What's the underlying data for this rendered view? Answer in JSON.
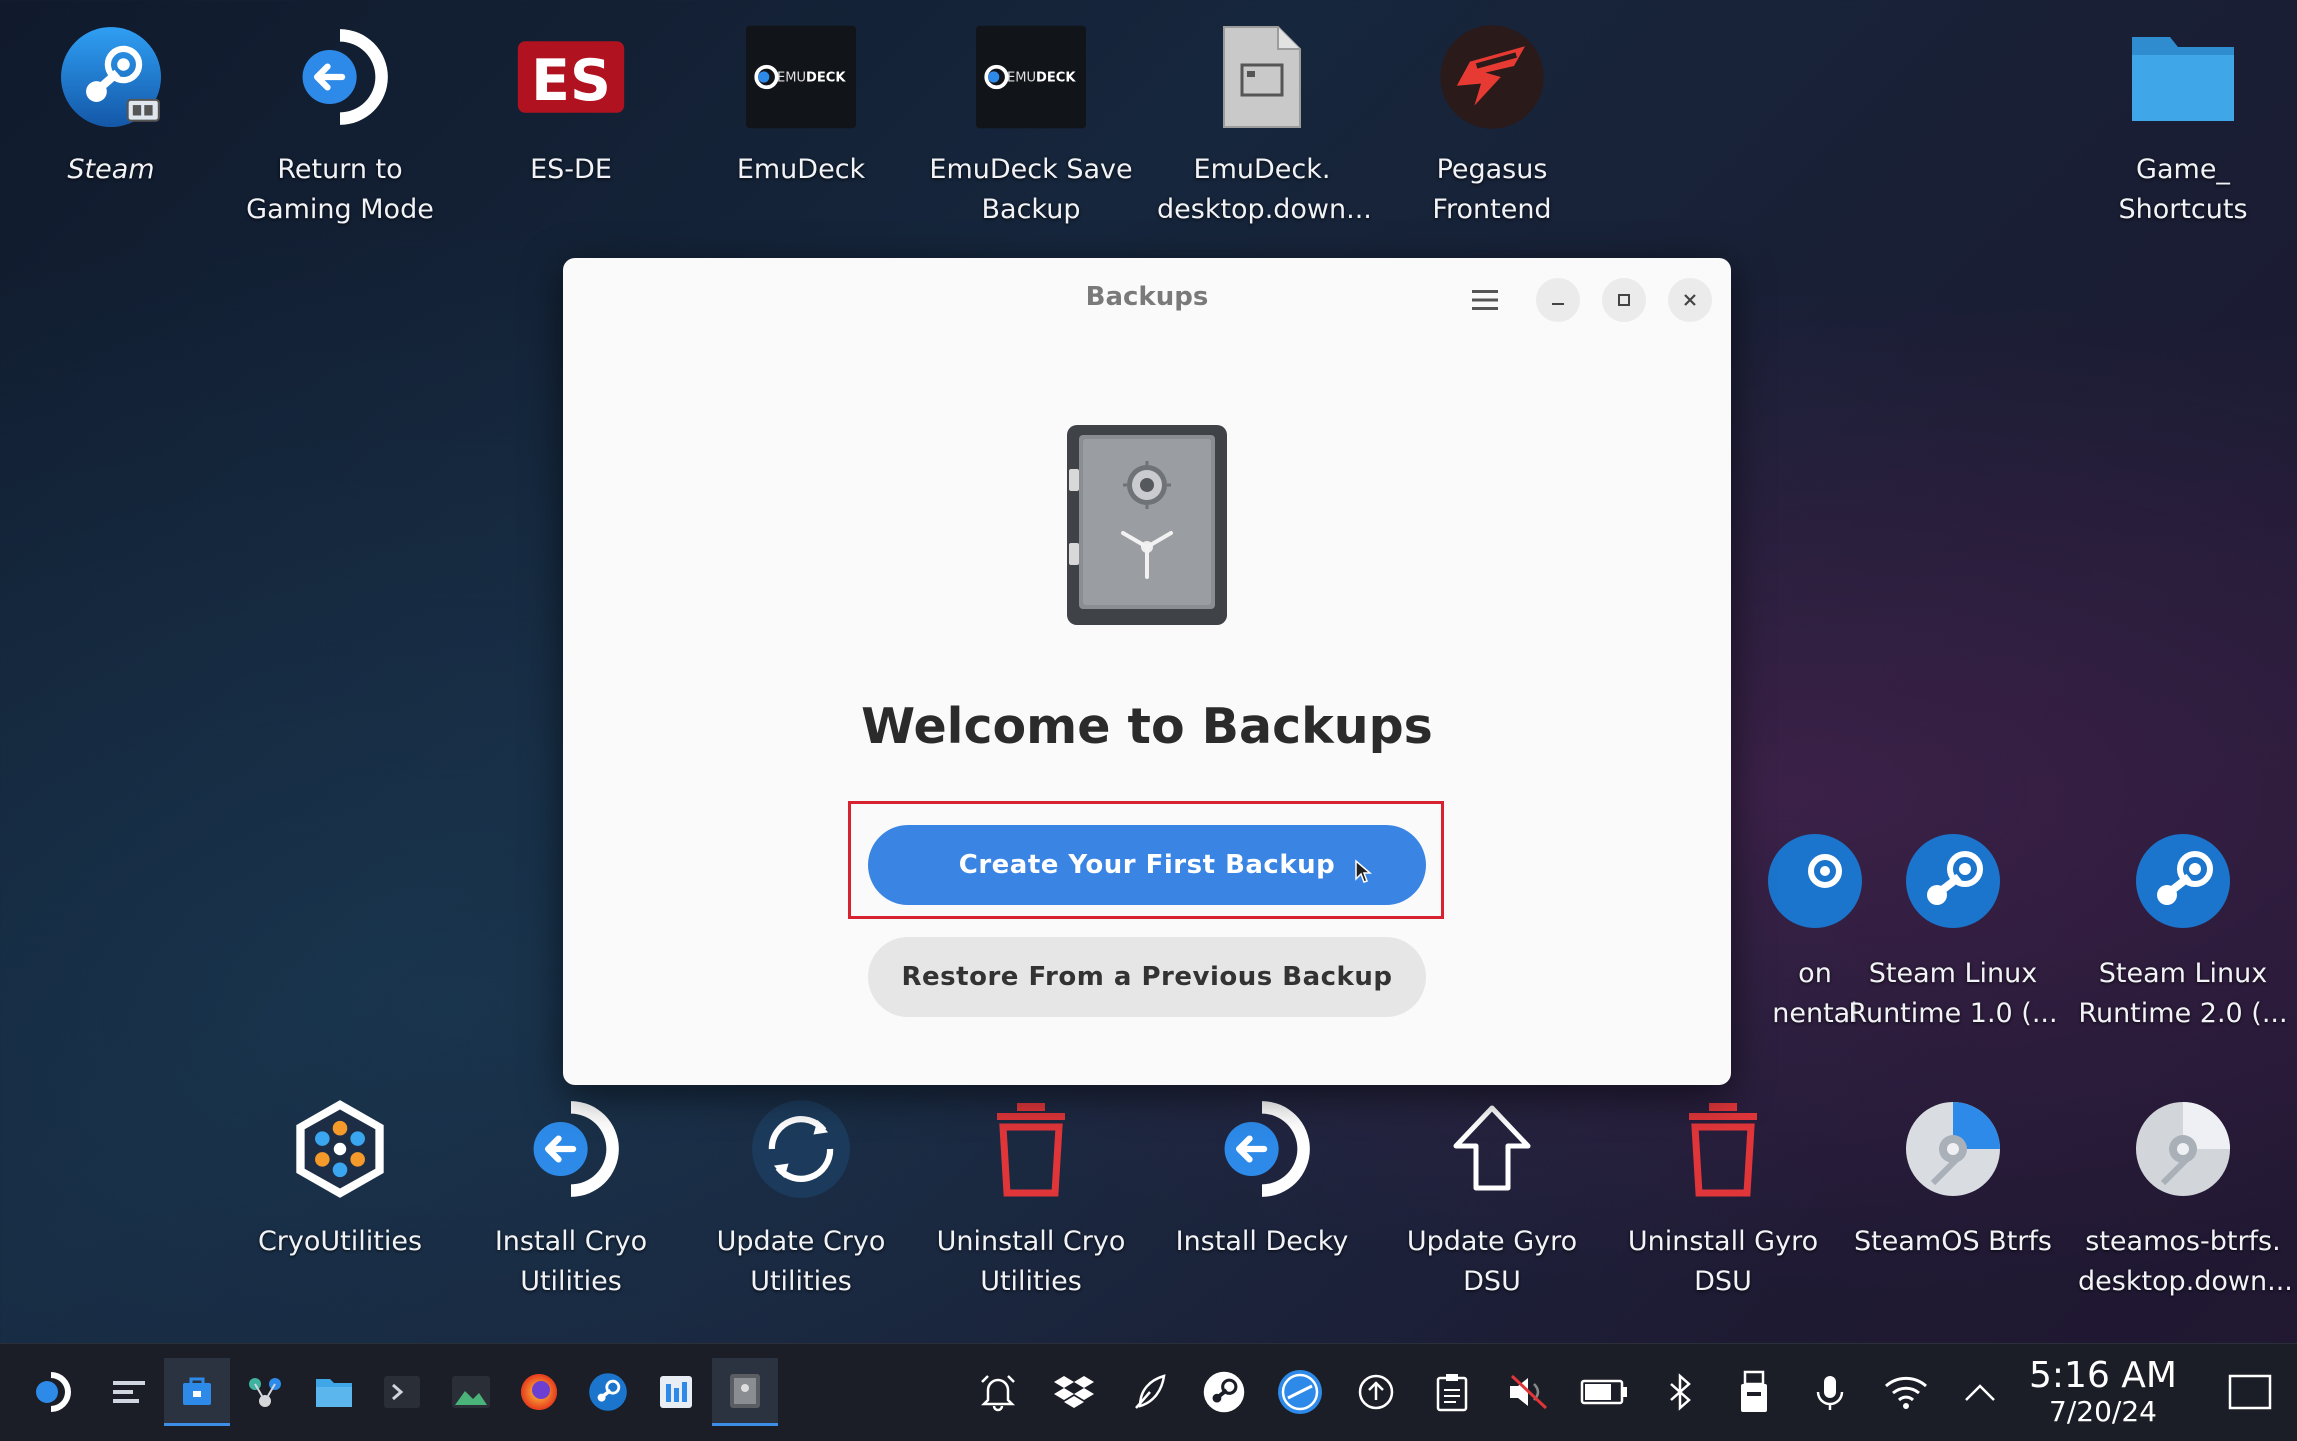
{
  "desktop": {
    "top_icons": [
      {
        "label": "Steam",
        "icon": "steam-icon"
      },
      {
        "label": "Return to\nGaming Mode",
        "icon": "return-arrow-icon"
      },
      {
        "label": "ES-DE",
        "icon": "es-de-icon"
      },
      {
        "label": "EmuDeck",
        "icon": "emudeck-icon"
      },
      {
        "label": "EmuDeck Save\nBackup",
        "icon": "emudeck-icon"
      },
      {
        "label": "EmuDeck.\ndesktop.down...",
        "icon": "file-icon"
      },
      {
        "label": "Pegasus\nFrontend",
        "icon": "pegasus-icon"
      },
      {
        "label": "Game_\nShortcuts",
        "icon": "folder-icon"
      }
    ],
    "mid_icons": [
      {
        "label": "on\nnental",
        "icon": "steam-icon"
      },
      {
        "label": "Steam Linux\nRuntime 1.0 (...",
        "icon": "steam-icon"
      },
      {
        "label": "Steam Linux\nRuntime 2.0 (...",
        "icon": "steam-icon"
      }
    ],
    "bottom_icons": [
      {
        "label": "CryoUtilities",
        "icon": "cryo-icon"
      },
      {
        "label": "Install Cryo\nUtilities",
        "icon": "return-arrow-icon"
      },
      {
        "label": "Update Cryo\nUtilities",
        "icon": "refresh-icon"
      },
      {
        "label": "Uninstall Cryo\nUtilities",
        "icon": "trash-icon"
      },
      {
        "label": "Install Decky",
        "icon": "return-arrow-icon"
      },
      {
        "label": "Update Gyro\nDSU",
        "icon": "up-arrow-icon"
      },
      {
        "label": "Uninstall Gyro\nDSU",
        "icon": "trash-icon"
      },
      {
        "label": "SteamOS Btrfs",
        "icon": "disc-icon"
      },
      {
        "label": "steamos-btrfs.\ndesktop.down...",
        "icon": "disc-icon"
      }
    ]
  },
  "dialog": {
    "title": "Backups",
    "heading": "Welcome to Backups",
    "primary_button": "Create Your First Backup",
    "secondary_button": "Restore From a Previous Backup",
    "highlight_color": "#d7232f",
    "accent_color": "#3a84e4"
  },
  "taskbar": {
    "apps": [
      "steamos-menu-icon",
      "task-manager-icon",
      "discover-store-icon",
      "network-icon",
      "file-manager-icon",
      "terminal-icon",
      "image-viewer-icon",
      "firefox-icon",
      "steam-icon",
      "meter-icon",
      "backups-icon"
    ],
    "tray": [
      "notifications-icon",
      "dropbox-icon",
      "feather-icon",
      "steam-tray-icon",
      "update-tray-icon",
      "upload-icon",
      "clipboard-icon",
      "volume-muted-icon",
      "battery-icon",
      "bluetooth-icon",
      "usb-drive-icon",
      "microphone-icon",
      "wifi-icon",
      "expand-tray-icon"
    ],
    "time": "5:16 AM",
    "date": "7/20/24"
  }
}
